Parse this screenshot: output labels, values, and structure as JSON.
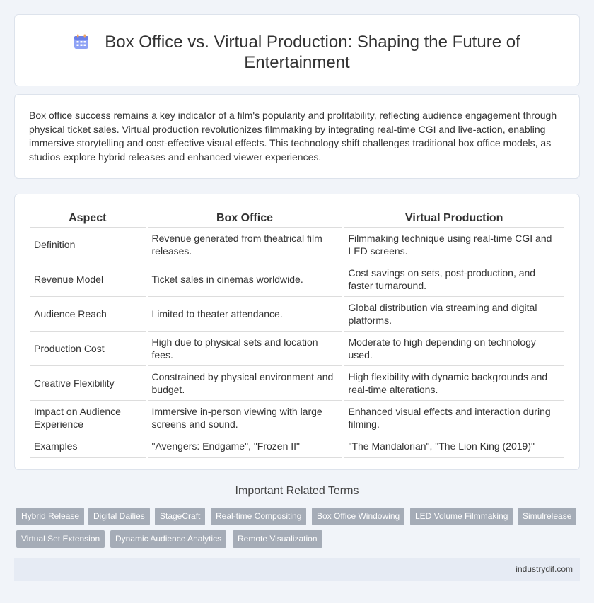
{
  "header": {
    "icon": "calendar-icon",
    "title_line1": "Box Office vs. Virtual Production: Shaping the Future of",
    "title_line2": "Entertainment"
  },
  "intro": {
    "text": "Box office success remains a key indicator of a film's popularity and profitability, reflecting audience engagement through physical ticket sales. Virtual production revolutionizes filmmaking by integrating real-time CGI and live-action, enabling immersive storytelling and cost-effective visual effects. This technology shift challenges traditional box office models, as studios explore hybrid releases and enhanced viewer experiences."
  },
  "table": {
    "headers": [
      "Aspect",
      "Box Office",
      "Virtual Production"
    ],
    "rows": [
      [
        "Definition",
        "Revenue generated from theatrical film releases.",
        "Filmmaking technique using real-time CGI and LED screens."
      ],
      [
        "Revenue Model",
        "Ticket sales in cinemas worldwide.",
        "Cost savings on sets, post-production, and faster turnaround."
      ],
      [
        "Audience Reach",
        "Limited to theater attendance.",
        "Global distribution via streaming and digital platforms."
      ],
      [
        "Production Cost",
        "High due to physical sets and location fees.",
        "Moderate to high depending on technology used."
      ],
      [
        "Creative Flexibility",
        "Constrained by physical environment and budget.",
        "High flexibility with dynamic backgrounds and real-time alterations."
      ],
      [
        "Impact on Audience Experience",
        "Immersive in-person viewing with large screens and sound.",
        "Enhanced visual effects and interaction during filming."
      ],
      [
        "Examples",
        "\"Avengers: Endgame\", \"Frozen II\"",
        "\"The Mandalorian\", \"The Lion King (2019)\""
      ]
    ]
  },
  "related": {
    "title": "Important Related Terms",
    "tags": [
      "Hybrid Release",
      "Digital Dailies",
      "StageCraft",
      "Real-time Compositing",
      "Box Office Windowing",
      "LED Volume Filmmaking",
      "Simulrelease",
      "Virtual Set Extension",
      "Dynamic Audience Analytics",
      "Remote Visualization"
    ]
  },
  "footer": {
    "site": "industrydif.com"
  },
  "colors": {
    "background": "#f1f4f9",
    "tag": "#a5acb7",
    "footer": "#e6ebf4",
    "icon_accent": "#7b8ff0"
  }
}
